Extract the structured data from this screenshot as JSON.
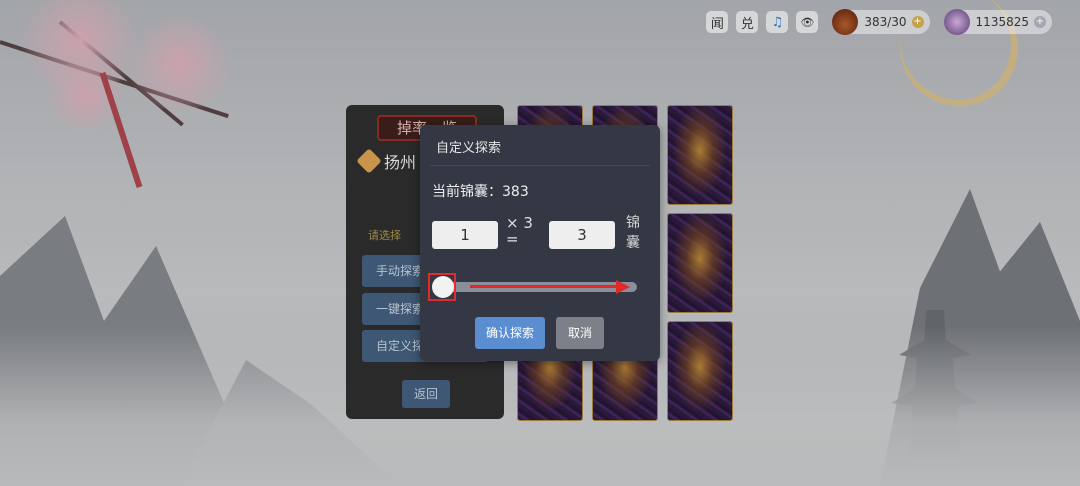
{
  "topbar": {
    "icons": [
      {
        "name": "news-icon",
        "glyph": "闻"
      },
      {
        "name": "redeem-icon",
        "glyph": "兑"
      },
      {
        "name": "music-icon",
        "glyph": "♫"
      },
      {
        "name": "eye-icon",
        "glyph": "👁"
      }
    ],
    "bag_count": "383/30",
    "coin_count": "1135825",
    "plus_glyph": "+"
  },
  "panel": {
    "title": "掉率一览",
    "location": "扬州",
    "hint": "请选择",
    "buttons": [
      "手动探索",
      "一键探索",
      "自定义探索"
    ],
    "back": "返回"
  },
  "dialog": {
    "title": "自定义探索",
    "current_label": "当前锦囊：383",
    "quantity": "1",
    "multiplier": "× 3",
    "equals": "=",
    "total": "3",
    "unit": "锦囊",
    "slider_value_percent": 0,
    "confirm": "确认探索",
    "cancel": "取消"
  },
  "colors": {
    "dialog_bg": "#343845",
    "confirm_btn": "#5b8ed1",
    "cancel_btn": "#7c8088",
    "annotation_red": "#e02828"
  }
}
